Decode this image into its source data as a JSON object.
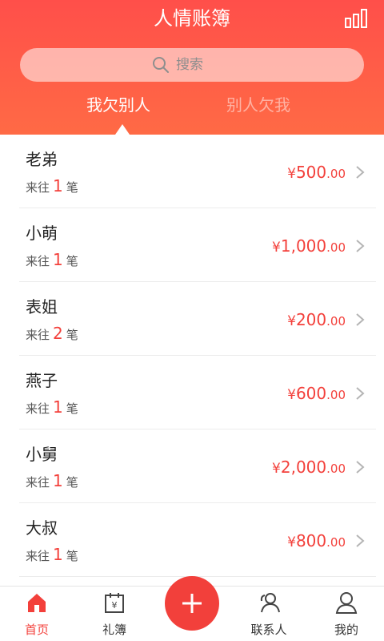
{
  "header": {
    "title": "人情账簿",
    "search_placeholder": "搜索",
    "tabs": [
      {
        "label": "我欠别人",
        "active": true
      },
      {
        "label": "别人欠我",
        "active": false
      }
    ]
  },
  "list": {
    "count_prefix": "来往",
    "count_suffix": "笔",
    "items": [
      {
        "name": "老弟",
        "count": "1",
        "currency": "¥",
        "amount_int": "500",
        "amount_dec": ".00"
      },
      {
        "name": "小萌",
        "count": "1",
        "currency": "¥",
        "amount_int": "1,000",
        "amount_dec": ".00"
      },
      {
        "name": "表姐",
        "count": "2",
        "currency": "¥",
        "amount_int": "200",
        "amount_dec": ".00"
      },
      {
        "name": "燕子",
        "count": "1",
        "currency": "¥",
        "amount_int": "600",
        "amount_dec": ".00"
      },
      {
        "name": "小舅",
        "count": "1",
        "currency": "¥",
        "amount_int": "2,000",
        "amount_dec": ".00"
      },
      {
        "name": "大叔",
        "count": "1",
        "currency": "¥",
        "amount_int": "800",
        "amount_dec": ".00"
      }
    ]
  },
  "tabbar": {
    "items": [
      {
        "label": "首页",
        "icon": "home-icon",
        "active": true
      },
      {
        "label": "礼簿",
        "icon": "ledger-icon",
        "active": false
      },
      {
        "label": "联系人",
        "icon": "contacts-icon",
        "active": false
      },
      {
        "label": "我的",
        "icon": "profile-icon",
        "active": false
      }
    ],
    "add_icon": "plus-icon"
  },
  "colors": {
    "accent": "#f3403b",
    "header_top": "#ff4f4a",
    "header_bottom": "#ff6a45"
  }
}
